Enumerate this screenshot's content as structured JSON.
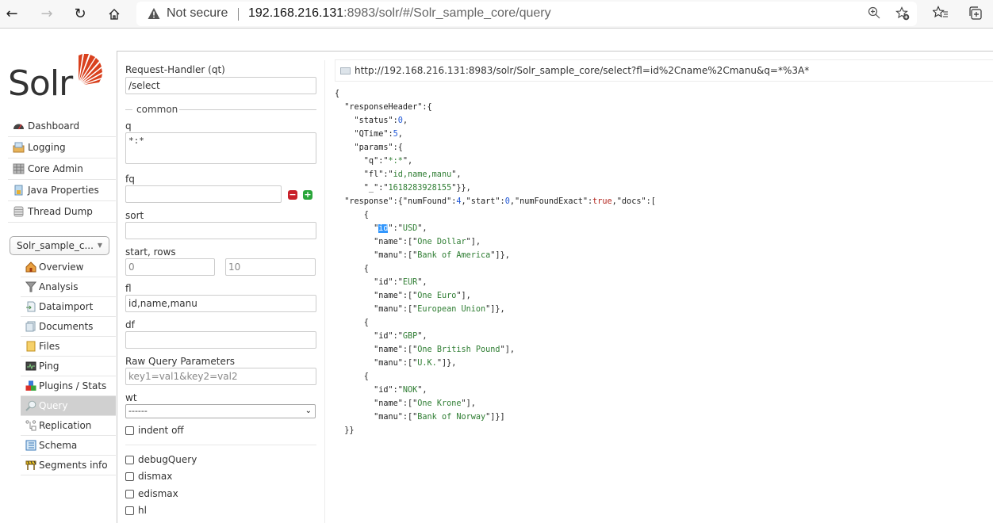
{
  "browser": {
    "security_label": "Not secure",
    "url_host": "192.168.216.131",
    "url_rest": ":8983/solr/#/Solr_sample_core/query",
    "icons": [
      "back-icon",
      "forward-icon",
      "reload-icon",
      "home-icon",
      "zoom-icon",
      "add-favorite-icon",
      "favorites-icon",
      "collections-icon"
    ]
  },
  "app": {
    "logo_text": "Solr",
    "accent_color": "#d9411e"
  },
  "sidebar": {
    "items": [
      {
        "label": "Dashboard",
        "icon": "dashboard-icon"
      },
      {
        "label": "Logging",
        "icon": "logging-icon"
      },
      {
        "label": "Core Admin",
        "icon": "core-admin-icon"
      },
      {
        "label": "Java Properties",
        "icon": "java-properties-icon"
      },
      {
        "label": "Thread Dump",
        "icon": "thread-dump-icon"
      }
    ],
    "core_selector": "Solr_sample_c...",
    "core_items": [
      {
        "label": "Overview",
        "icon": "overview-icon"
      },
      {
        "label": "Analysis",
        "icon": "analysis-icon"
      },
      {
        "label": "Dataimport",
        "icon": "dataimport-icon"
      },
      {
        "label": "Documents",
        "icon": "documents-icon"
      },
      {
        "label": "Files",
        "icon": "files-icon"
      },
      {
        "label": "Ping",
        "icon": "ping-icon"
      },
      {
        "label": "Plugins / Stats",
        "icon": "plugins-icon"
      },
      {
        "label": "Query",
        "icon": "query-icon",
        "active": true
      },
      {
        "label": "Replication",
        "icon": "replication-icon"
      },
      {
        "label": "Schema",
        "icon": "schema-icon"
      },
      {
        "label": "Segments info",
        "icon": "segments-icon"
      }
    ]
  },
  "form": {
    "qt_label": "Request-Handler (qt)",
    "qt_value": "/select",
    "common_legend": "common",
    "q_label": "q",
    "q_value": "*:*",
    "fq_label": "fq",
    "fq_value": "",
    "sort_label": "sort",
    "sort_value": "",
    "start_rows_label": "start, rows",
    "start_value": "0",
    "rows_value": "10",
    "fl_label": "fl",
    "fl_value": "id,name,manu",
    "df_label": "df",
    "df_value": "",
    "raw_label": "Raw Query Parameters",
    "raw_placeholder": "key1=val1&key2=val2",
    "wt_label": "wt",
    "wt_value": "------",
    "indent_label": "indent off",
    "debug_label": "debugQuery",
    "dismax_label": "dismax",
    "edismax_label": "edismax",
    "hl_label": "hl"
  },
  "result": {
    "request_url": "http://192.168.216.131:8983/solr/Solr_sample_core/select?fl=id%2Cname%2Cmanu&q=*%3A*",
    "status": "0",
    "qtime": "5",
    "params": {
      "q": "*:*",
      "fl": "id,name,manu",
      "_": "1618283928155"
    },
    "numFound": "4",
    "start": "0",
    "numFoundExact": "true",
    "docs": [
      {
        "id": "USD",
        "name": "One Dollar",
        "manu": "Bank of America"
      },
      {
        "id": "EUR",
        "name": "One Euro",
        "manu": "European Union"
      },
      {
        "id": "GBP",
        "name": "One British Pound",
        "manu": "U.K."
      },
      {
        "id": "NOK",
        "name": "One Krone",
        "manu": "Bank of Norway"
      }
    ]
  }
}
